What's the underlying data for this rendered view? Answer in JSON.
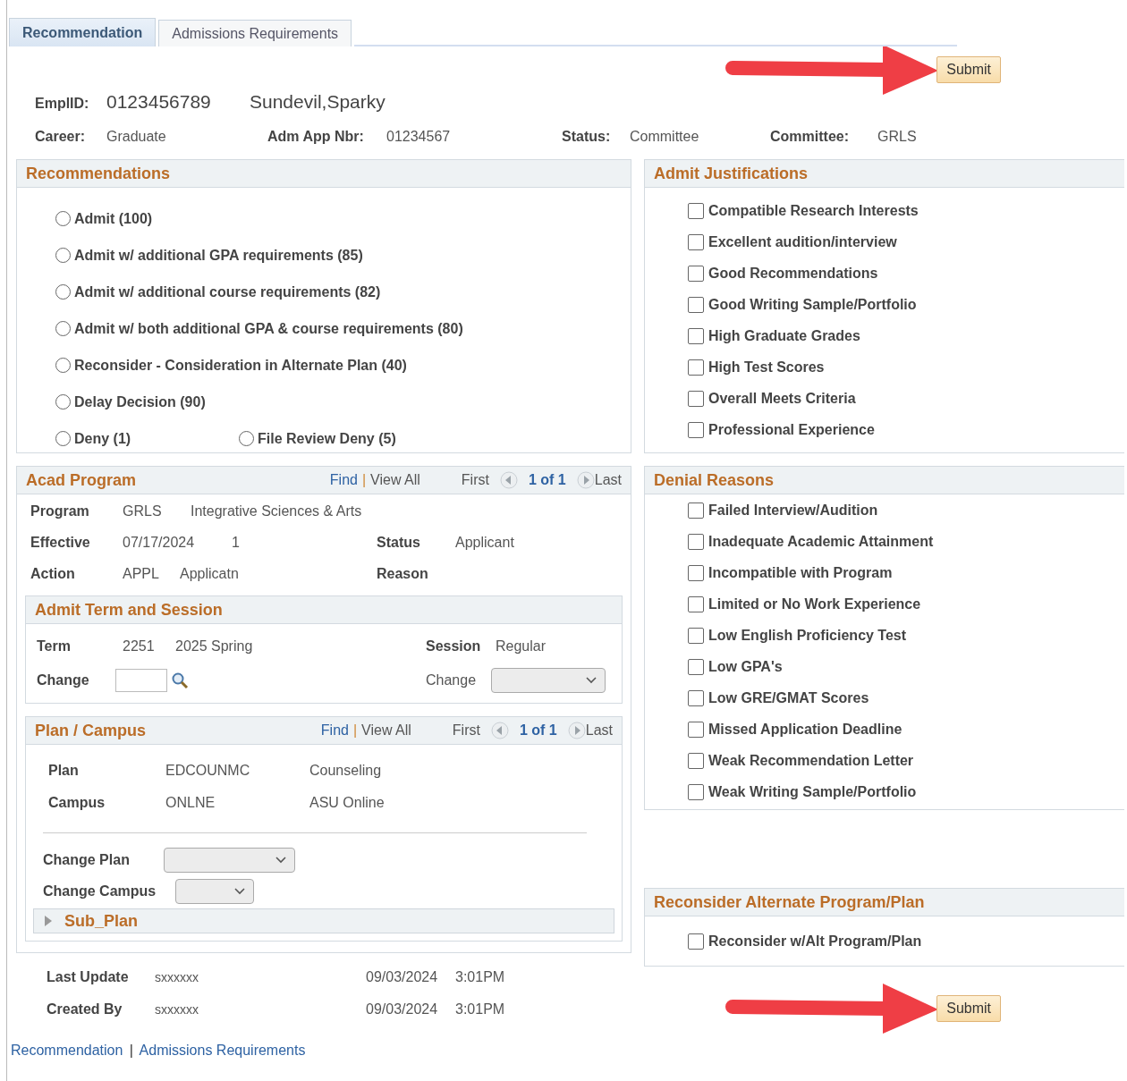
{
  "tabs": [
    {
      "label": "Recommendation",
      "selected": true
    },
    {
      "label": "Admissions Requirements",
      "selected": false
    }
  ],
  "submit_top": "Submit",
  "header": {
    "emplid_label": "EmplID:",
    "emplid": "0123456789",
    "name": "Sundevil,Sparky",
    "fields": [
      {
        "label": "Career:",
        "value": "Graduate"
      },
      {
        "label": "Adm App Nbr:",
        "value": "01234567"
      },
      {
        "label": "Status:",
        "value": "Committee"
      },
      {
        "label": "Committee:",
        "value": "GRLS"
      }
    ]
  },
  "recommendations": {
    "title": "Recommendations",
    "rows": [
      {
        "options": [
          {
            "label": "Admit (100)",
            "selected": false
          }
        ]
      },
      {
        "options": [
          {
            "label": "Admit w/ additional GPA requirements (85)",
            "selected": false
          }
        ]
      },
      {
        "options": [
          {
            "label": "Admit w/ additional course requirements (82)",
            "selected": false
          }
        ]
      },
      {
        "options": [
          {
            "label": "Admit w/ both additional GPA & course requirements (80)",
            "selected": false
          }
        ]
      },
      {
        "options": [
          {
            "label": "Reconsider - Consideration in Alternate Plan (40)",
            "selected": false
          }
        ]
      },
      {
        "options": [
          {
            "label": "Delay Decision (90)",
            "selected": false
          }
        ]
      },
      {
        "options": [
          {
            "label": "Deny (1)",
            "selected": false
          },
          {
            "label": "File Review Deny (5)",
            "selected": false
          }
        ]
      }
    ]
  },
  "admit_justifications": {
    "title": "Admit Justifications",
    "items": [
      {
        "label": "Compatible Research Interests",
        "checked": false
      },
      {
        "label": "Excellent audition/interview",
        "checked": false
      },
      {
        "label": "Good Recommendations",
        "checked": false
      },
      {
        "label": "Good Writing Sample/Portfolio",
        "checked": false
      },
      {
        "label": "High Graduate Grades",
        "checked": false
      },
      {
        "label": "High Test Scores",
        "checked": false
      },
      {
        "label": "Overall Meets Criteria",
        "checked": false
      },
      {
        "label": "Professional Experience",
        "checked": false
      }
    ]
  },
  "acad_program": {
    "title": "Acad Program",
    "nav": {
      "find": "Find",
      "separator": "|",
      "view_all": "View All",
      "first": "First",
      "count": "1 of 1",
      "last": "Last"
    },
    "program": {
      "label": "Program",
      "code": "GRLS",
      "description": "Integrative Sciences & Arts"
    },
    "effective": {
      "label": "Effective",
      "date": "07/17/2024",
      "sequence": "1"
    },
    "status": {
      "label": "Status",
      "value": "Applicant"
    },
    "action": {
      "label": "Action",
      "code": "APPL",
      "description": "Applicatn"
    },
    "reason": {
      "label": "Reason"
    },
    "admit_term": {
      "title": "Admit Term and Session",
      "term_label": "Term",
      "term_code": "2251",
      "term_description": "2025 Spring",
      "change_label": "Change",
      "session_label": "Session",
      "session": "Regular",
      "session_change_label": "Change"
    },
    "plan_campus": {
      "title": "Plan / Campus",
      "nav": {
        "find": "Find",
        "separator": "|",
        "view_all": "View All",
        "first": "First",
        "count": "1 of 1",
        "last": "Last"
      },
      "plan": {
        "label": "Plan",
        "code": "EDCOUNMC",
        "description": "Counseling"
      },
      "campus": {
        "label": "Campus",
        "code": "ONLNE",
        "description": "ASU Online"
      },
      "change_plan_label": "Change Plan",
      "change_campus_label": "Change Campus",
      "sub_plan": {
        "title": "Sub_Plan",
        "expanded": false
      }
    }
  },
  "denial_reasons": {
    "title": "Denial Reasons",
    "items": [
      {
        "label": "Failed Interview/Audition",
        "checked": false
      },
      {
        "label": "Inadequate Academic Attainment",
        "checked": false
      },
      {
        "label": "Incompatible with Program",
        "checked": false
      },
      {
        "label": "Limited or No Work Experience",
        "checked": false
      },
      {
        "label": "Low English Proficiency Test",
        "checked": false
      },
      {
        "label": "Low GPA's",
        "checked": false
      },
      {
        "label": "Low GRE/GMAT Scores",
        "checked": false
      },
      {
        "label": "Missed Application Deadline",
        "checked": false
      },
      {
        "label": "Weak Recommendation Letter",
        "checked": false
      },
      {
        "label": "Weak Writing Sample/Portfolio",
        "checked": false
      }
    ]
  },
  "reconsider": {
    "title": "Reconsider Alternate Program/Plan",
    "items": [
      {
        "label": "Reconsider w/Alt Program/Plan",
        "checked": false
      }
    ]
  },
  "audit": [
    {
      "label": "Last Update",
      "user": "sxxxxxx",
      "date": "09/03/2024",
      "time": "3:01PM"
    },
    {
      "label": "Created By",
      "user": "sxxxxxx",
      "date": "09/03/2024",
      "time": "3:01PM"
    }
  ],
  "submit_bottom": "Submit",
  "footer_links": {
    "separator": "|",
    "links": [
      {
        "label": "Recommendation"
      },
      {
        "label": "Admissions Requirements"
      }
    ]
  }
}
